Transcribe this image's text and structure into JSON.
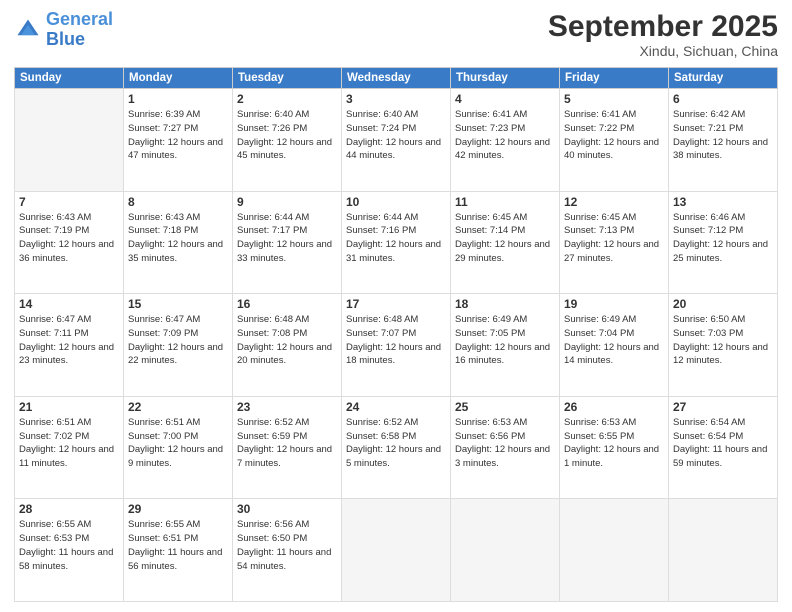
{
  "logo": {
    "line1": "General",
    "line2": "Blue"
  },
  "title": "September 2025",
  "location": "Xindu, Sichuan, China",
  "days_of_week": [
    "Sunday",
    "Monday",
    "Tuesday",
    "Wednesday",
    "Thursday",
    "Friday",
    "Saturday"
  ],
  "weeks": [
    [
      {
        "day": "",
        "empty": true
      },
      {
        "day": "1",
        "sunrise": "6:39 AM",
        "sunset": "7:27 PM",
        "daylight": "12 hours and 47 minutes."
      },
      {
        "day": "2",
        "sunrise": "6:40 AM",
        "sunset": "7:26 PM",
        "daylight": "12 hours and 45 minutes."
      },
      {
        "day": "3",
        "sunrise": "6:40 AM",
        "sunset": "7:24 PM",
        "daylight": "12 hours and 44 minutes."
      },
      {
        "day": "4",
        "sunrise": "6:41 AM",
        "sunset": "7:23 PM",
        "daylight": "12 hours and 42 minutes."
      },
      {
        "day": "5",
        "sunrise": "6:41 AM",
        "sunset": "7:22 PM",
        "daylight": "12 hours and 40 minutes."
      },
      {
        "day": "6",
        "sunrise": "6:42 AM",
        "sunset": "7:21 PM",
        "daylight": "12 hours and 38 minutes."
      }
    ],
    [
      {
        "day": "7",
        "sunrise": "6:43 AM",
        "sunset": "7:19 PM",
        "daylight": "12 hours and 36 minutes."
      },
      {
        "day": "8",
        "sunrise": "6:43 AM",
        "sunset": "7:18 PM",
        "daylight": "12 hours and 35 minutes."
      },
      {
        "day": "9",
        "sunrise": "6:44 AM",
        "sunset": "7:17 PM",
        "daylight": "12 hours and 33 minutes."
      },
      {
        "day": "10",
        "sunrise": "6:44 AM",
        "sunset": "7:16 PM",
        "daylight": "12 hours and 31 minutes."
      },
      {
        "day": "11",
        "sunrise": "6:45 AM",
        "sunset": "7:14 PM",
        "daylight": "12 hours and 29 minutes."
      },
      {
        "day": "12",
        "sunrise": "6:45 AM",
        "sunset": "7:13 PM",
        "daylight": "12 hours and 27 minutes."
      },
      {
        "day": "13",
        "sunrise": "6:46 AM",
        "sunset": "7:12 PM",
        "daylight": "12 hours and 25 minutes."
      }
    ],
    [
      {
        "day": "14",
        "sunrise": "6:47 AM",
        "sunset": "7:11 PM",
        "daylight": "12 hours and 23 minutes."
      },
      {
        "day": "15",
        "sunrise": "6:47 AM",
        "sunset": "7:09 PM",
        "daylight": "12 hours and 22 minutes."
      },
      {
        "day": "16",
        "sunrise": "6:48 AM",
        "sunset": "7:08 PM",
        "daylight": "12 hours and 20 minutes."
      },
      {
        "day": "17",
        "sunrise": "6:48 AM",
        "sunset": "7:07 PM",
        "daylight": "12 hours and 18 minutes."
      },
      {
        "day": "18",
        "sunrise": "6:49 AM",
        "sunset": "7:05 PM",
        "daylight": "12 hours and 16 minutes."
      },
      {
        "day": "19",
        "sunrise": "6:49 AM",
        "sunset": "7:04 PM",
        "daylight": "12 hours and 14 minutes."
      },
      {
        "day": "20",
        "sunrise": "6:50 AM",
        "sunset": "7:03 PM",
        "daylight": "12 hours and 12 minutes."
      }
    ],
    [
      {
        "day": "21",
        "sunrise": "6:51 AM",
        "sunset": "7:02 PM",
        "daylight": "12 hours and 11 minutes."
      },
      {
        "day": "22",
        "sunrise": "6:51 AM",
        "sunset": "7:00 PM",
        "daylight": "12 hours and 9 minutes."
      },
      {
        "day": "23",
        "sunrise": "6:52 AM",
        "sunset": "6:59 PM",
        "daylight": "12 hours and 7 minutes."
      },
      {
        "day": "24",
        "sunrise": "6:52 AM",
        "sunset": "6:58 PM",
        "daylight": "12 hours and 5 minutes."
      },
      {
        "day": "25",
        "sunrise": "6:53 AM",
        "sunset": "6:56 PM",
        "daylight": "12 hours and 3 minutes."
      },
      {
        "day": "26",
        "sunrise": "6:53 AM",
        "sunset": "6:55 PM",
        "daylight": "12 hours and 1 minute."
      },
      {
        "day": "27",
        "sunrise": "6:54 AM",
        "sunset": "6:54 PM",
        "daylight": "11 hours and 59 minutes."
      }
    ],
    [
      {
        "day": "28",
        "sunrise": "6:55 AM",
        "sunset": "6:53 PM",
        "daylight": "11 hours and 58 minutes."
      },
      {
        "day": "29",
        "sunrise": "6:55 AM",
        "sunset": "6:51 PM",
        "daylight": "11 hours and 56 minutes."
      },
      {
        "day": "30",
        "sunrise": "6:56 AM",
        "sunset": "6:50 PM",
        "daylight": "11 hours and 54 minutes."
      },
      {
        "day": "",
        "empty": true
      },
      {
        "day": "",
        "empty": true
      },
      {
        "day": "",
        "empty": true
      },
      {
        "day": "",
        "empty": true
      }
    ]
  ]
}
